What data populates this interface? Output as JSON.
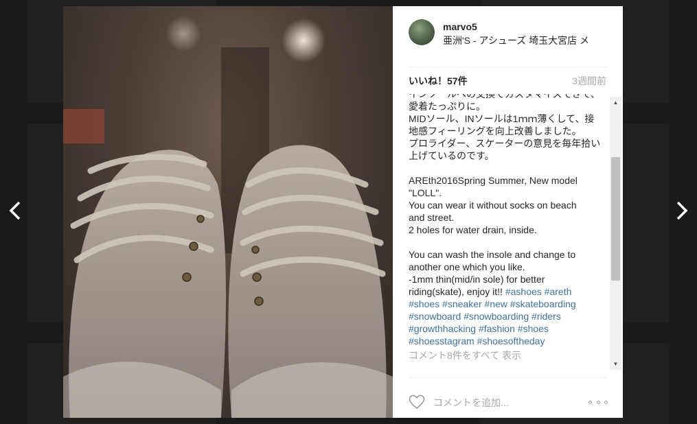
{
  "post": {
    "username": "marvo5",
    "location": "亜洲'S - アシューズ 埼玉大宮店 メ",
    "likes": "いいね！57件",
    "time_ago": "3週間前",
    "caption_lines": [
      [
        {
          "t": "インソールへの交換でカスタマイズできて、"
        }
      ],
      [
        {
          "t": "愛着たっぷりに。"
        }
      ],
      [
        {
          "t": "MIDソール、INソールは1ｍｍ薄くして、接"
        }
      ],
      [
        {
          "t": "地感フィーリングを向上改善しました。"
        }
      ],
      [
        {
          "t": "プロライダー、スケーターの意見を毎年拾い"
        }
      ],
      [
        {
          "t": "上げているのです。"
        }
      ],
      [
        {
          "t": ""
        }
      ],
      [
        {
          "t": "AREth2016Spring Summer, New model"
        }
      ],
      [
        {
          "t": "\"LOLL\"."
        }
      ],
      [
        {
          "t": "You can wear it without socks on beach"
        }
      ],
      [
        {
          "t": "and street."
        }
      ],
      [
        {
          "t": "2 holes for water drain, inside."
        }
      ],
      [
        {
          "t": ""
        }
      ],
      [
        {
          "t": "You can wash the insole and change to"
        }
      ],
      [
        {
          "t": "another one which you like."
        }
      ],
      [
        {
          "t": "-1mm thin(mid/in sole) for better"
        }
      ],
      [
        {
          "t": "riding(skate), enjoy it!! "
        },
        {
          "t": "#ashoes",
          "tag": true
        },
        {
          "t": " "
        },
        {
          "t": "#areth",
          "tag": true
        }
      ],
      [
        {
          "t": "#shoes",
          "tag": true
        },
        {
          "t": " "
        },
        {
          "t": "#sneaker",
          "tag": true
        },
        {
          "t": " "
        },
        {
          "t": "#new",
          "tag": true
        },
        {
          "t": " "
        },
        {
          "t": "#skateboarding",
          "tag": true
        }
      ],
      [
        {
          "t": "#snowboard",
          "tag": true
        },
        {
          "t": " "
        },
        {
          "t": "#snowboarding",
          "tag": true
        },
        {
          "t": " "
        },
        {
          "t": "#riders",
          "tag": true
        }
      ],
      [
        {
          "t": "#growthhacking",
          "tag": true
        },
        {
          "t": " "
        },
        {
          "t": "#fashion",
          "tag": true
        },
        {
          "t": " "
        },
        {
          "t": "#shoes",
          "tag": true
        }
      ],
      [
        {
          "t": "#shoesstagram",
          "tag": true
        },
        {
          "t": " "
        },
        {
          "t": "#shoesoftheday",
          "tag": true
        }
      ]
    ],
    "view_all_comments": "コメント8件をすべて 表示",
    "comment_placeholder": "コメントを追加...",
    "icons": {
      "prev": "chevron-left-icon",
      "next": "chevron-right-icon",
      "like": "heart-icon",
      "more": "more-options-icon"
    },
    "colors": {
      "hashtag": "#3f729b",
      "muted": "#a5a7aa",
      "text": "#262626"
    }
  }
}
